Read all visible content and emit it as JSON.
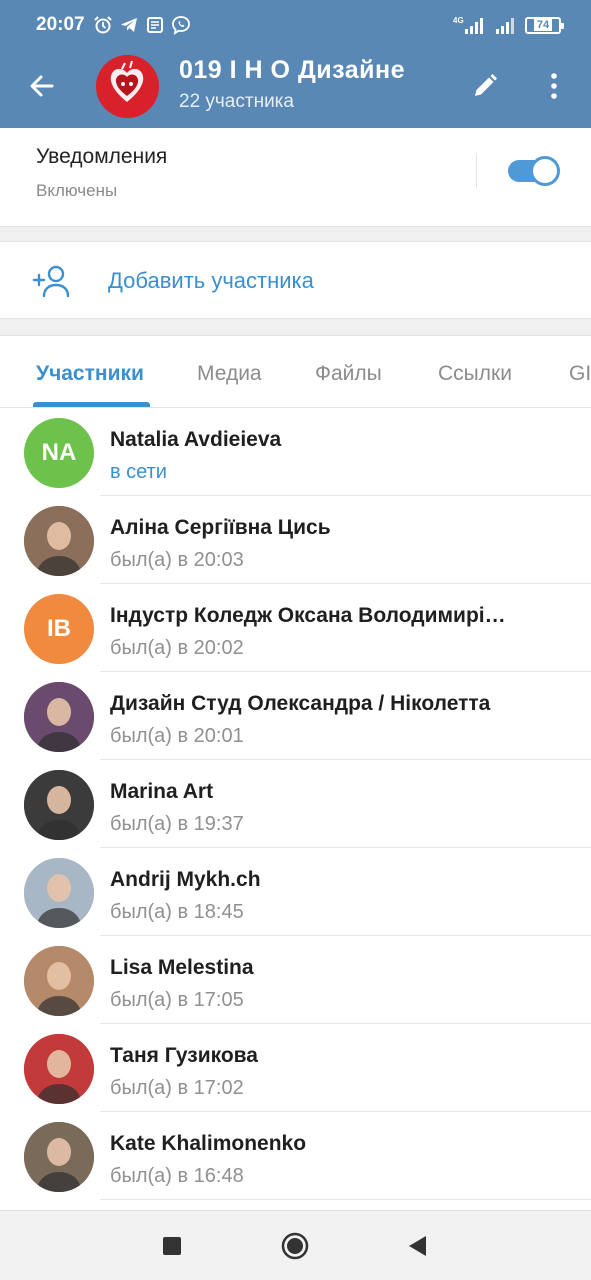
{
  "status_bar": {
    "time": "20:07",
    "network": "4G",
    "battery": "74"
  },
  "header": {
    "title": "019   І Н О Дизайне",
    "subtitle": "22 участника"
  },
  "notifications": {
    "title": "Уведомления",
    "state": "Включены",
    "enabled": true
  },
  "add_member": {
    "label": "Добавить участника"
  },
  "tabs": [
    {
      "label": "Участники",
      "active": true
    },
    {
      "label": "Медиа"
    },
    {
      "label": "Файлы"
    },
    {
      "label": "Ссылки"
    },
    {
      "label": "GI"
    }
  ],
  "members": [
    {
      "name": "Natalia Avdieieva",
      "status": "в сети",
      "initials": "NA",
      "avatar_color": "#6cc24a"
    },
    {
      "name": "Аліна Сергіївна Цись",
      "status": "был(а) в 20:03",
      "avatar_color": "#8c6f5a"
    },
    {
      "name": "Індустр Коледж Оксана Володимирі…",
      "status": "был(а) в 20:02",
      "initials": "ІВ",
      "avatar_color": "#f08a3e"
    },
    {
      "name": "Дизайн Студ Олександра / Ніколетта",
      "status": "был(а) в 20:01",
      "avatar_color": "#6a4b6e"
    },
    {
      "name": "Marina Art",
      "status": "был(а) в 19:37",
      "avatar_color": "#3b3b3b"
    },
    {
      "name": "Andrij Mykh.ch",
      "status": "был(а) в 18:45",
      "avatar_color": "#a8b7c6"
    },
    {
      "name": "Lisa Melestina",
      "status": "был(а) в 17:05",
      "avatar_color": "#b58a6a"
    },
    {
      "name": "Таня Гузикова",
      "status": "был(а) в 17:02",
      "avatar_color": "#c23a3a"
    },
    {
      "name": "Kate Khalimonenko",
      "status": "был(а) в 16:48",
      "avatar_color": "#7a6a5a"
    }
  ],
  "colors": {
    "header": "#5a88b5",
    "accent": "#3a8fcf",
    "online": "#3a8fcf",
    "toggle": "#4e99d6"
  }
}
